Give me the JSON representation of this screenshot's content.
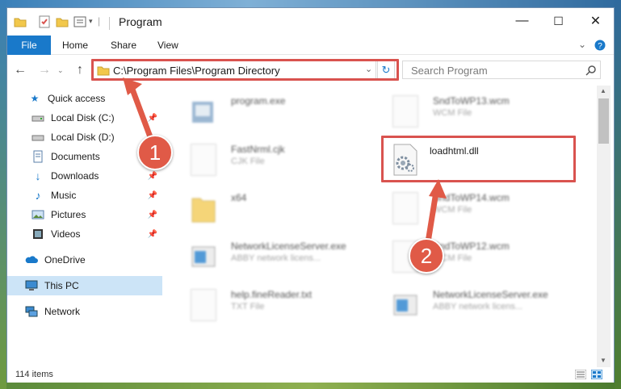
{
  "window": {
    "title": "Program",
    "controls": {
      "minimize": "—",
      "maximize": "☐",
      "close": "✕"
    }
  },
  "ribbon": {
    "tabs": [
      {
        "label": "File"
      },
      {
        "label": "Home"
      },
      {
        "label": "Share"
      },
      {
        "label": "View"
      }
    ],
    "expand_icon": "chevron-down-icon",
    "help_icon": "help-icon"
  },
  "address_bar": {
    "path": "C:\\Program Files\\Program Directory",
    "search_placeholder": "Search Program"
  },
  "nav_pane": {
    "items": [
      {
        "label": "Quick access",
        "icon": "star-icon"
      },
      {
        "label": "Local Disk (C:)",
        "icon": "drive-icon"
      },
      {
        "label": "Local Disk (D:)",
        "icon": "drive-icon"
      },
      {
        "label": "Documents",
        "icon": "documents-icon"
      },
      {
        "label": "Downloads",
        "icon": "download-icon"
      },
      {
        "label": "Music",
        "icon": "music-icon"
      },
      {
        "label": "Pictures",
        "icon": "pictures-icon"
      },
      {
        "label": "Videos",
        "icon": "videos-icon"
      },
      {
        "label": "OneDrive",
        "icon": "cloud-icon"
      },
      {
        "label": "This PC",
        "icon": "computer-icon"
      },
      {
        "label": "Network",
        "icon": "network-icon"
      }
    ]
  },
  "files": [
    {
      "name": "program.exe",
      "type": ""
    },
    {
      "name": "SndToWP13.wcm",
      "type": "WCM File"
    },
    {
      "name": "FastNrml.cjk",
      "type": "CJK File"
    },
    {
      "name": "loadhtml.dll",
      "type": ""
    },
    {
      "name": "x64",
      "type": ""
    },
    {
      "name": "SndToWP14.wcm",
      "type": "WCM File"
    },
    {
      "name": "NetworkLicenseServer.exe",
      "type": "ABBY network licens..."
    },
    {
      "name": "SndToWP12.wcm",
      "type": "WCM File"
    },
    {
      "name": "help.fineReader.txt",
      "type": "TXT File"
    },
    {
      "name": "NetworkLicenseServer.exe",
      "type": "ABBY network licens..."
    }
  ],
  "status_bar": {
    "item_count": "114 items"
  },
  "callouts": [
    {
      "number": "1"
    },
    {
      "number": "2"
    }
  ],
  "colors": {
    "accent": "#1979ca",
    "highlight": "#d9534f",
    "badge": "#e05a47"
  }
}
